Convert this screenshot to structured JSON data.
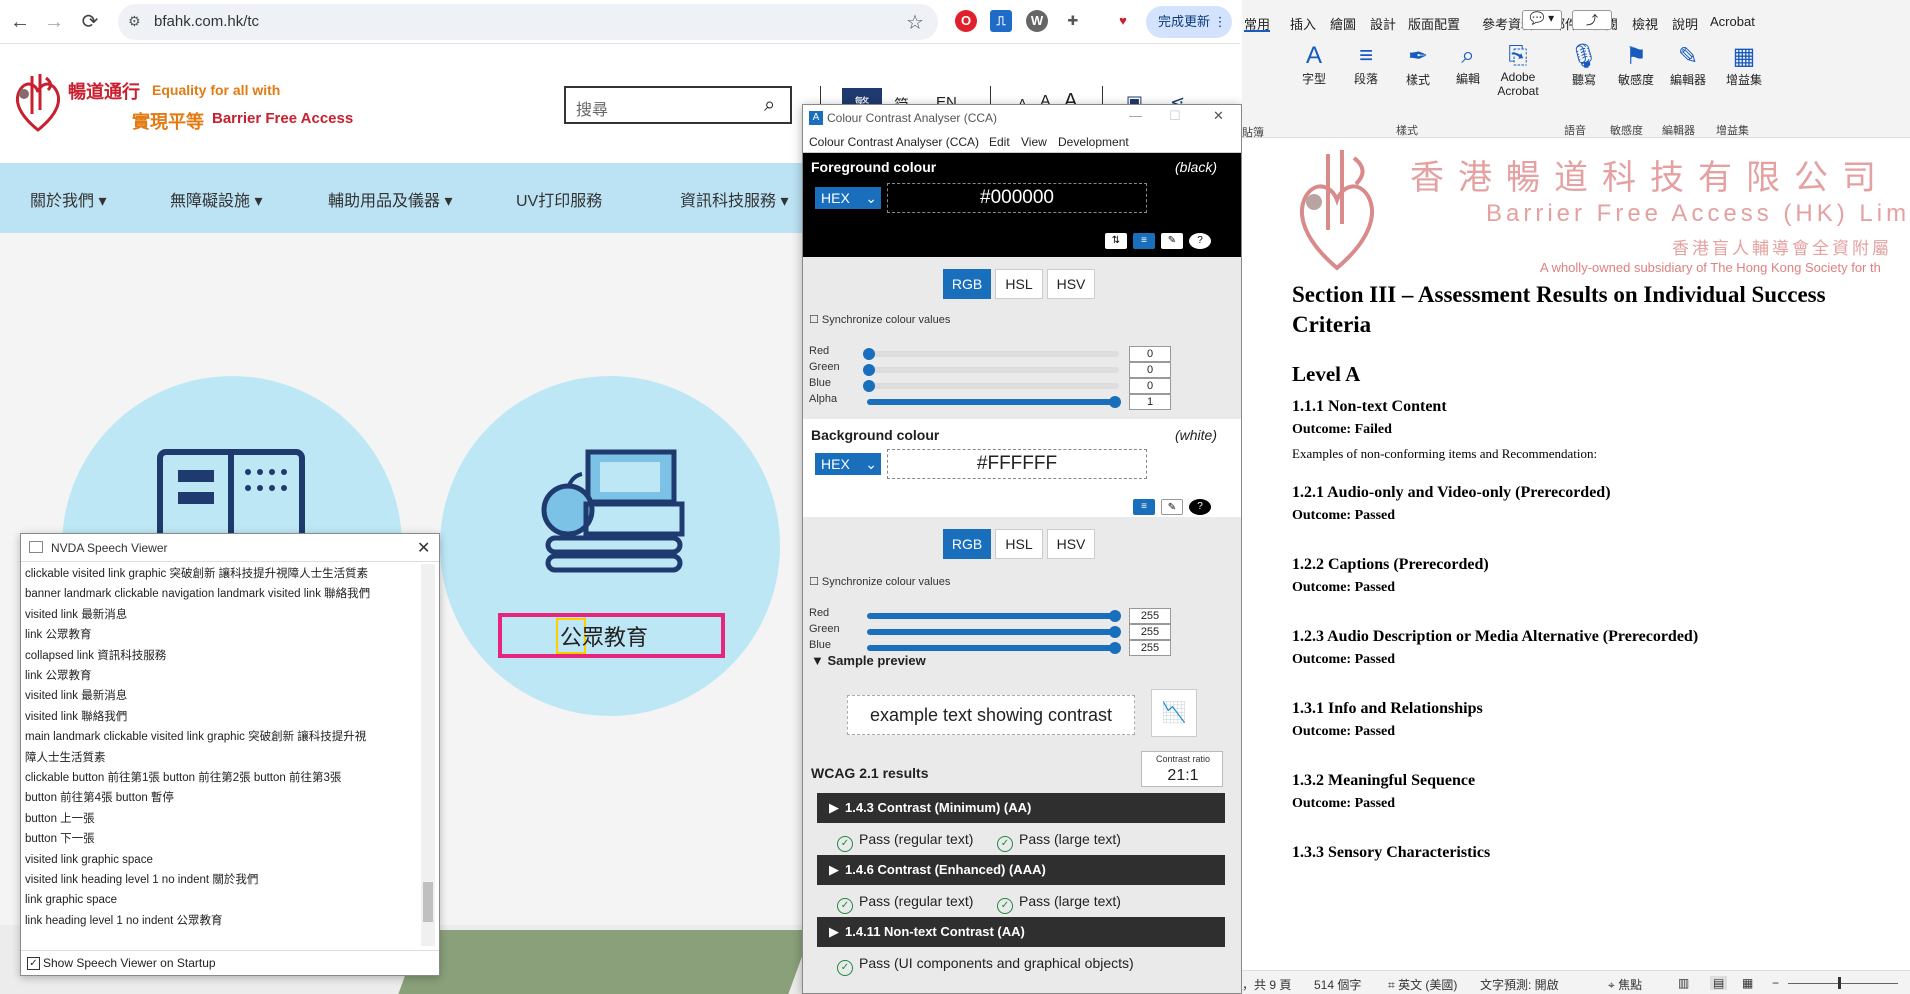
{
  "browser": {
    "url": "bfahk.com.hk/tc",
    "update_button": "完成更新"
  },
  "site": {
    "logo_zh1": "暢道通行",
    "logo_en1": "Equality for all with",
    "logo_zh2": "實現平等",
    "logo_en2": "Barrier Free Access",
    "search_placeholder": "搜尋",
    "lang": [
      "繁",
      "简",
      "EN"
    ],
    "font_sizes": [
      "A",
      "A",
      "A"
    ],
    "nav": [
      "關於我們",
      "無障礙設施",
      "輔助用品及儀器",
      "UV打印服務",
      "資訊科技服務"
    ],
    "focused_link": "公眾教育"
  },
  "nvda": {
    "title": "NVDA Speech Viewer",
    "lines": [
      "clickable  visited  link    graphic    突破創新 讓科技提升視障人士生活質素",
      "banner landmark  clickable    navigation landmark    visited  link    聯絡我們",
      "visited  link    最新消息",
      "link    公眾教育",
      "collapsed  link    資訊科技服務",
      "link    公眾教育",
      "visited  link    最新消息",
      "visited  link    聯絡我們",
      "main landmark    clickable  visited  link    graphic    突破創新 讓科技提升視",
      "障人士生活質素",
      "clickable  button    前往第1張  button    前往第2張  button    前往第3張",
      "button    前往第4張  button    暫停",
      "button    上一張",
      "button    下一張",
      "visited  link    graphic    space",
      "visited  link    heading    level 1  no indent  關於我們",
      "link    graphic    space",
      "link    heading    level 1  no indent  公眾教育"
    ],
    "show_on_startup": "Show Speech Viewer on Startup"
  },
  "cca": {
    "title": "Colour Contrast Analyser (CCA)",
    "menu": [
      "Colour Contrast Analyser (CCA)",
      "Edit",
      "View",
      "Development"
    ],
    "fg_heading": "Foreground colour",
    "fg_name": "(black)",
    "fg_format": "HEX",
    "fg_hex": "#000000",
    "modes": [
      "RGB",
      "HSL",
      "HSV"
    ],
    "sync_label": "Synchronize colour values",
    "fg_channels": [
      {
        "label": "Red",
        "value": "0",
        "level": 0
      },
      {
        "label": "Green",
        "value": "0",
        "level": 0
      },
      {
        "label": "Blue",
        "value": "0",
        "level": 0
      },
      {
        "label": "Alpha",
        "value": "1",
        "level": 1
      }
    ],
    "bg_heading": "Background colour",
    "bg_name": "(white)",
    "bg_format": "HEX",
    "bg_hex": "#FFFFFF",
    "bg_channels": [
      {
        "label": "Red",
        "value": "255",
        "level": 1
      },
      {
        "label": "Green",
        "value": "255",
        "level": 1
      },
      {
        "label": "Blue",
        "value": "255",
        "level": 1
      }
    ],
    "preview_heading": "Sample preview",
    "preview_text": "example text showing contrast",
    "results_heading": "WCAG 2.1 results",
    "ratio_label": "Contrast ratio",
    "ratio_value": "21:1",
    "criteria": [
      {
        "title": "1.4.3 Contrast (Minimum) (AA)",
        "passes": [
          "Pass (regular text)",
          "Pass (large text)"
        ]
      },
      {
        "title": "1.4.6 Contrast (Enhanced) (AAA)",
        "passes": [
          "Pass (regular text)",
          "Pass (large text)"
        ]
      },
      {
        "title": "1.4.11 Non-text Contrast (AA)",
        "passes": [
          "Pass (UI components and graphical objects)"
        ]
      }
    ]
  },
  "word": {
    "tabs": [
      "常用",
      "插入",
      "繪圖",
      "設計",
      "版面配置",
      "參考資料",
      "郵件",
      "校閱",
      "檢視",
      "說明",
      "Acrobat"
    ],
    "ribbon": [
      {
        "label": "字型"
      },
      {
        "label": "段落"
      },
      {
        "label": "樣式"
      },
      {
        "label": "編輯"
      },
      {
        "label": "Adobe Acrobat"
      },
      {
        "label": "聽寫"
      },
      {
        "label": "敏感度"
      },
      {
        "label": "編輯器"
      },
      {
        "label": "增益集"
      }
    ],
    "ribbon_groups": [
      "樣式",
      "語音",
      "敏感度",
      "編輯器",
      "增益集"
    ],
    "clip_caption": "貼簿",
    "letterhead_zh": "香港暢道科技有限公司",
    "letterhead_en": "Barrier Free Access (HK) Lim",
    "letterhead_sub_zh": "香港盲人輔導會全資附屬",
    "letterhead_sub_en": "A wholly-owned subsidiary of The Hong Kong Society for th",
    "section_title_1": "Section III – Assessment Results on Individual Success",
    "section_title_2": "Criteria",
    "level": "Level A",
    "items": [
      {
        "heading": "1.1.1 Non-text Content",
        "outcome": "Outcome: Failed",
        "note": "Examples of non-conforming items and Recommendation:"
      },
      {
        "heading": "1.2.1 Audio-only and Video-only (Prerecorded)",
        "outcome": "Outcome: Passed"
      },
      {
        "heading": "1.2.2 Captions (Prerecorded)",
        "outcome": "Outcome: Passed"
      },
      {
        "heading": "1.2.3 Audio Description or Media Alternative (Prerecorded)",
        "outcome": "Outcome: Passed"
      },
      {
        "heading": "1.3.1 Info and Relationships",
        "outcome": "Outcome: Passed"
      },
      {
        "heading": "1.3.2 Meaningful Sequence",
        "outcome": "Outcome: Passed"
      },
      {
        "heading": "1.3.3 Sensory Characteristics"
      }
    ],
    "status": {
      "pages": "，共 9 頁",
      "words": "514 個字",
      "lang": "英文 (美國)",
      "prediction": "文字預測: 開啟",
      "focus": "焦點"
    }
  }
}
